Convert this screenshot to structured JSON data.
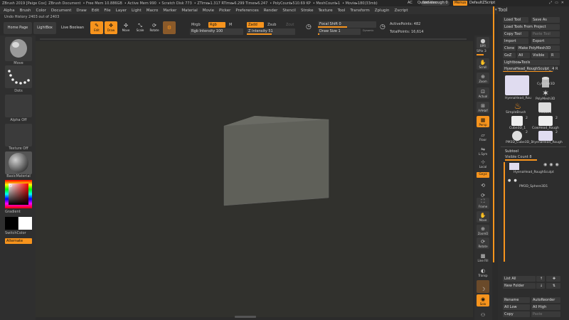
{
  "titlebar": {
    "items": [
      "ZBrush 2019 [Paige Cox]",
      "ZBrush Document",
      "• Free Mem 10.886GB",
      "• Active Mem 990",
      "• Scratch Disk 773",
      "• ZTime▸1.317 RTime▸6.299 Timer▸6.247",
      "• PolyCount▸510.69 KP",
      "• MeshCount▸1",
      "• Movie▸180(33mb)"
    ],
    "ac": "AC",
    "quicksave": "QuickSave",
    "seethrough": "See-through  0",
    "menus": "Menus",
    "defaultscript": "DefaultZScript"
  },
  "menubar": [
    "Alpha",
    "Brush",
    "Color",
    "Document",
    "Draw",
    "Edit",
    "File",
    "Layer",
    "Light",
    "Macro",
    "Marker",
    "Material",
    "Movie",
    "Picker",
    "Preferences",
    "Render",
    "Stencil",
    "Stroke",
    "Texture",
    "Tool",
    "Transform",
    "Zplugin",
    "Zscript"
  ],
  "undo": "Undo History 2403 out of 2403",
  "toolbar": {
    "homepage": "Home Page",
    "lightbox": "LightBox",
    "liveboolean": "Live Boolean",
    "edit": "Edit",
    "draw": "Draw",
    "move": "Move",
    "scale": "Scale",
    "rotate": "Rotate",
    "mrgb": "Mrgb",
    "rgb": "Rgb",
    "m": "M",
    "zadd": "Zadd",
    "zsub": "Zsub",
    "zcut": "Zcut",
    "rgb_intensity": "Rgb Intensity 100",
    "z_intensity": "Z Intensity 51",
    "focal_shift": "Focal Shift 0",
    "draw_size": "Draw Size 1",
    "dynamic": "Dynamic",
    "active_points": "ActivePoints: 482",
    "total_points": "TotalPoints: 16,614"
  },
  "leftshelf": {
    "move": "Move",
    "dots": "Dots",
    "alpha_off": "Alpha Off",
    "texture_off": "Texture Off",
    "basic_material": "BasicMaterial",
    "gradient": "Gradient",
    "switch_color": "SwitchColor",
    "alternate": "Alternate"
  },
  "rightshelf": [
    "BPR",
    "SPix 3",
    "Scroll",
    "Zoom",
    "Actual",
    "AAHalf",
    "Persp",
    "Floor",
    "L.Sym",
    "Local",
    "Gxyz",
    "",
    "Frame",
    "Move",
    "ZoomD",
    "Rotate",
    "Line Fill",
    "PolyF",
    "Transp",
    "Ghost",
    "Solo",
    "Dynamic"
  ],
  "toolpanel": {
    "title": "Tool",
    "load_tool": "Load Tool",
    "save_as": "Save As",
    "load_from_project": "Load Tools From Project",
    "copy_tool": "Copy Tool",
    "paste_tool": "Paste Tool",
    "import": "Import",
    "export": "Export",
    "clone": "Clone",
    "make_polymesh": "Make PolyMesh3D",
    "goz": "GoZ",
    "all": "All",
    "visible": "Visible",
    "r": "R",
    "lightbox_tools": "Lightbox▸Tools",
    "current_tool": "HyenaHead_RoughSculpt_",
    "current_tool_count": "48",
    "r2": "R",
    "thumbs": [
      {
        "label": "HyenaHead_Rou",
        "count": ""
      },
      {
        "label": "Cylinder3D",
        "count": ""
      },
      {
        "label": "PolyMesh3D",
        "count": ""
      },
      {
        "label": "SimpleBrush",
        "count": ""
      },
      {
        "label": "Avatar3",
        "count": ""
      },
      {
        "label": "Cube3D_1",
        "count": "2"
      },
      {
        "label": "CowHead_Rough",
        "count": "2"
      },
      {
        "label": "PM3D_Cube3D_1",
        "count": "2"
      },
      {
        "label": "HyenaHead_Rough",
        "count": "2"
      }
    ]
  },
  "subtool": {
    "header": "Subtool",
    "visible_count": "Visible Count 8",
    "rows": [
      {
        "name": "HyenaHead_RoughSculpt"
      },
      {
        "name": "PM3D_Sphere3D1"
      }
    ]
  },
  "bottompanel": {
    "list_all": "List All",
    "new_folder": "New Folder",
    "rename": "Rename",
    "auto_reorder": "AutoReorder",
    "all_low": "All Low",
    "all_high": "All High",
    "copy": "Copy",
    "paste": "Paste"
  },
  "colors": {
    "accent": "#f7941d",
    "background": "#2b2b2b",
    "viewport": "#31312d",
    "cube_face": "#5e5f58"
  }
}
